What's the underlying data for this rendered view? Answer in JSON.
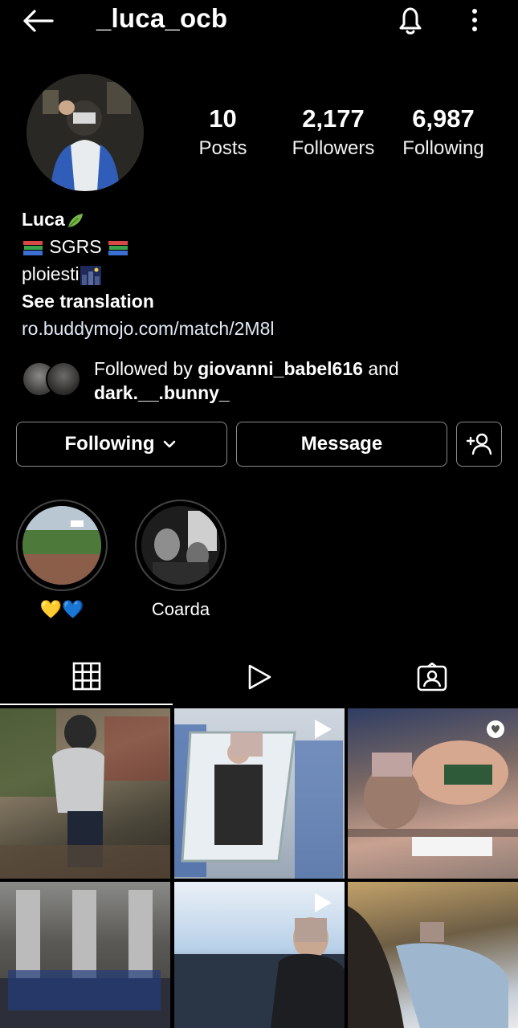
{
  "header": {
    "username": "_luca_ocb",
    "back_icon": "arrow-left-icon",
    "bell_icon": "bell-icon",
    "menu_icon": "more-vertical-icon"
  },
  "stats": {
    "posts": {
      "value": "10",
      "label": "Posts"
    },
    "followers": {
      "value": "2,177",
      "label": "Followers"
    },
    "following": {
      "value": "6,987",
      "label": "Following"
    }
  },
  "bio": {
    "name": "Luca",
    "line2": "SGRS",
    "location": "ploiesti",
    "translation": "See translation",
    "link": "ro.buddymojo.com/match/2M8l"
  },
  "followed_by": {
    "prefix": "Followed by",
    "user1": "giovanni_babel616",
    "joiner": "and",
    "user2": "dark.__.bunny_"
  },
  "actions": {
    "following": "Following",
    "message": "Message",
    "add_icon": "add-person-icon"
  },
  "highlights": [
    {
      "label": "💛💙"
    },
    {
      "label": "Coarda"
    }
  ],
  "tabs": [
    {
      "icon": "grid-icon",
      "active": true
    },
    {
      "icon": "reels-play-icon",
      "active": false
    },
    {
      "icon": "tagged-person-icon",
      "active": false
    }
  ],
  "colors": {
    "background": "#000000",
    "text": "#ffffff",
    "border": "#8a8a8a"
  }
}
